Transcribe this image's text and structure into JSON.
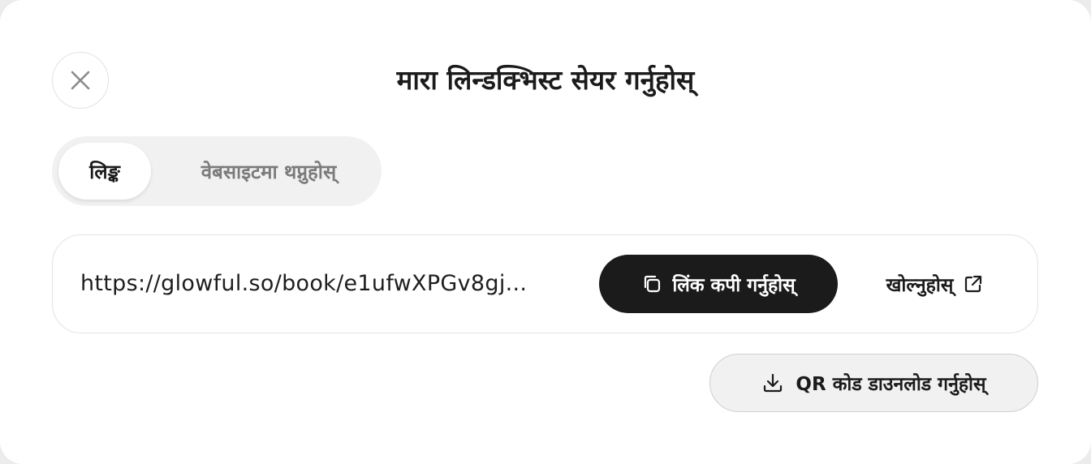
{
  "dialog": {
    "title": "मारा लिन्डक्भिस्ट सेयर गर्नुहोस्",
    "close_icon": "close-icon"
  },
  "tabs": [
    {
      "label": "लिङ्क",
      "active": true
    },
    {
      "label": "वेबसाइटमा थप्नुहोस्",
      "active": false
    }
  ],
  "share_link": {
    "url": "https://glowful.so/book/e1ufwXPGv8gj...",
    "copy_label": "लिंक कपी गर्नुहोस्",
    "copy_icon": "copy-icon",
    "open_label": "खोल्नुहोस्",
    "open_icon": "external-link-icon"
  },
  "qr": {
    "download_label": "QR कोड डाउनलोड गर्नुहोस्",
    "download_icon": "download-icon"
  },
  "colors": {
    "primary_button": "#1b1b1b",
    "tab_bg": "#f1f1f1",
    "inactive_text": "#7b7b7b"
  }
}
